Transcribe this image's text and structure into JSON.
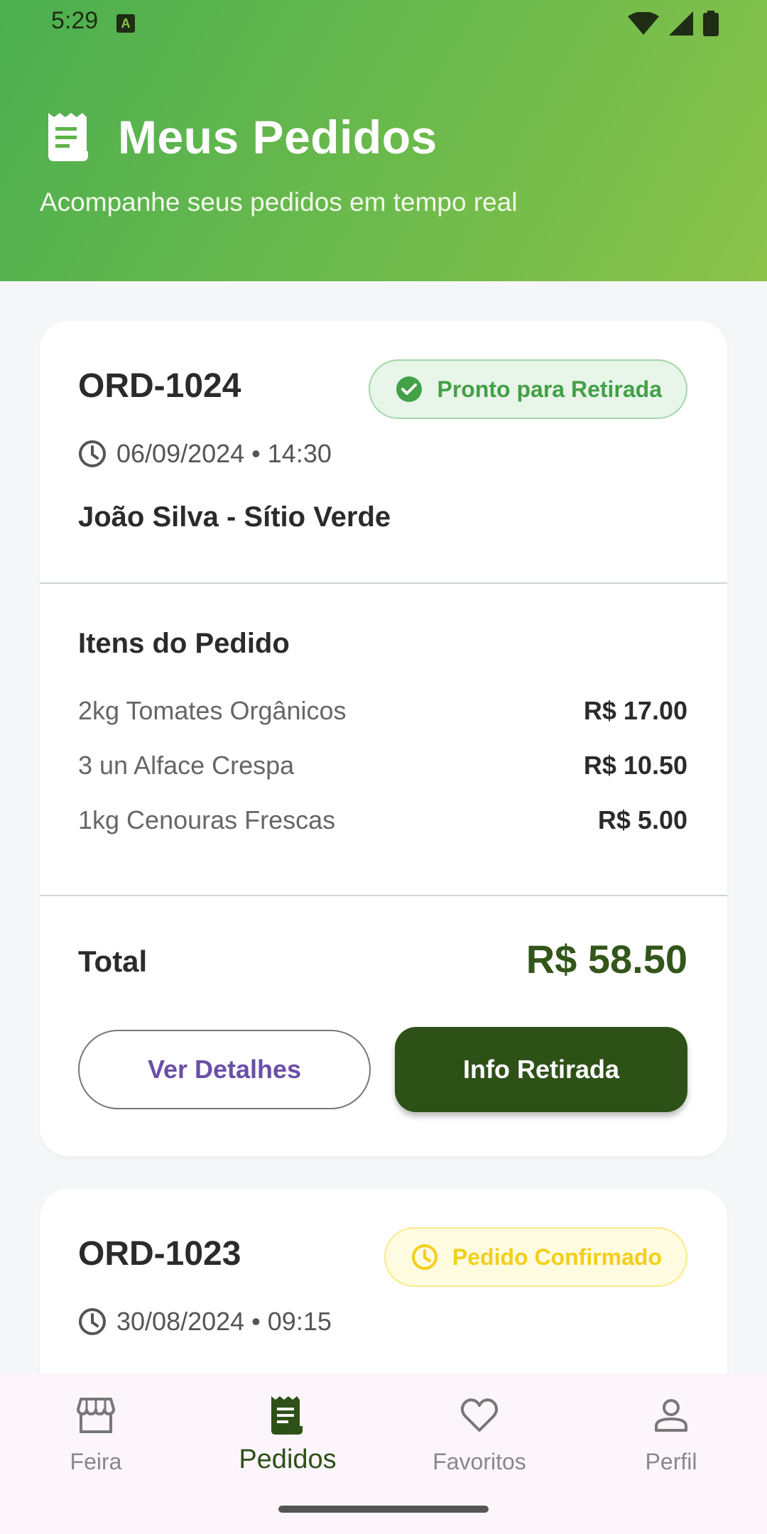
{
  "status_bar": {
    "time": "5:29",
    "notification_icon": "A"
  },
  "header": {
    "icon": "receipt-icon",
    "title": "Meus Pedidos",
    "subtitle": "Acompanhe seus pedidos em tempo real"
  },
  "orders": [
    {
      "id": "ORD-1024",
      "status": "Pronto para Retirada",
      "status_icon": "check-circle-icon",
      "status_color": "#43a047",
      "date": "06/09/2024 • 14:30",
      "farmer": "João Silva - Sítio Verde",
      "items_title": "Itens do Pedido",
      "items": [
        {
          "name": "2kg Tomates Orgânicos",
          "price": "R$ 17.00"
        },
        {
          "name": "3 un Alface Crespa",
          "price": "R$ 10.50"
        },
        {
          "name": "1kg Cenouras Frescas",
          "price": "R$ 5.00"
        }
      ],
      "total_label": "Total",
      "total": "R$ 58.50",
      "details_button": "Ver Detalhes",
      "pickup_button": "Info Retirada"
    },
    {
      "id": "ORD-1023",
      "status": "Pedido Confirmado",
      "status_icon": "clock-icon",
      "status_color": "#f2cf1b",
      "date": "30/08/2024 • 09:15"
    }
  ],
  "bottom_nav": [
    {
      "label": "Feira",
      "icon": "storefront-icon",
      "active": false
    },
    {
      "label": "Pedidos",
      "icon": "receipt-icon",
      "active": true
    },
    {
      "label": "Favoritos",
      "icon": "heart-icon",
      "active": false
    },
    {
      "label": "Perfil",
      "icon": "person-icon",
      "active": false
    }
  ],
  "colors": {
    "header_start": "#4caf50",
    "header_end": "#8bc34a",
    "primary_dark": "#2e5118",
    "total_text": "#33561a"
  }
}
